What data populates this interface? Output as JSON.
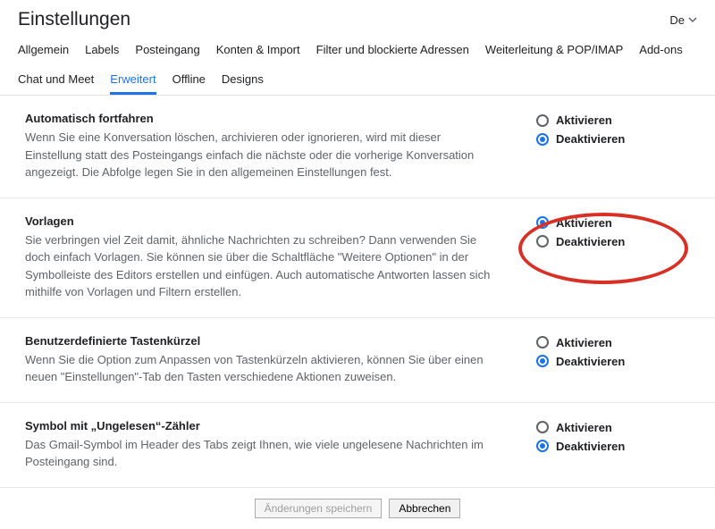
{
  "header": {
    "title": "Einstellungen",
    "language": "De"
  },
  "tabs": {
    "row1": [
      "Allgemein",
      "Labels",
      "Posteingang",
      "Konten & Import",
      "Filter und blockierte Adressen",
      "Weiterleitung & POP/IMAP",
      "Add-ons"
    ],
    "row2": [
      "Chat und Meet",
      "Erweitert",
      "Offline",
      "Designs"
    ],
    "active": "Erweitert"
  },
  "options": {
    "enable": "Aktivieren",
    "disable": "Deaktivieren"
  },
  "sections": [
    {
      "title": "Automatisch fortfahren",
      "desc": "Wenn Sie eine Konversation löschen, archivieren oder ignorieren, wird mit dieser Einstellung statt des Posteingangs einfach die nächste oder die vorherige Konversation angezeigt. Die Abfolge legen Sie in den allgemeinen Einstellungen fest.",
      "selected": "disable",
      "highlight": false
    },
    {
      "title": "Vorlagen",
      "desc": "Sie verbringen viel Zeit damit, ähnliche Nachrichten zu schreiben? Dann verwenden Sie doch einfach Vorlagen. Sie können sie über die Schaltfläche \"Weitere Optionen\" in der Symbolleiste des Editors erstellen und einfügen. Auch automatische Antworten lassen sich mithilfe von Vorlagen und Filtern erstellen.",
      "selected": "enable",
      "highlight": true
    },
    {
      "title": "Benutzerdefinierte Tastenkürzel",
      "desc": "Wenn Sie die Option zum Anpassen von Tastenkürzeln aktivieren, können Sie über einen neuen \"Einstellungen\"-Tab den Tasten verschiedene Aktionen zuweisen.",
      "selected": "disable",
      "highlight": false
    },
    {
      "title": "Symbol mit „Ungelesen“-Zähler",
      "desc": "Das Gmail-Symbol im Header des Tabs zeigt Ihnen, wie viele ungelesene Nachrichten im Posteingang sind.",
      "selected": "disable",
      "highlight": false
    }
  ],
  "footer": {
    "save": "Änderungen speichern",
    "cancel": "Abbrechen",
    "save_disabled": true
  }
}
